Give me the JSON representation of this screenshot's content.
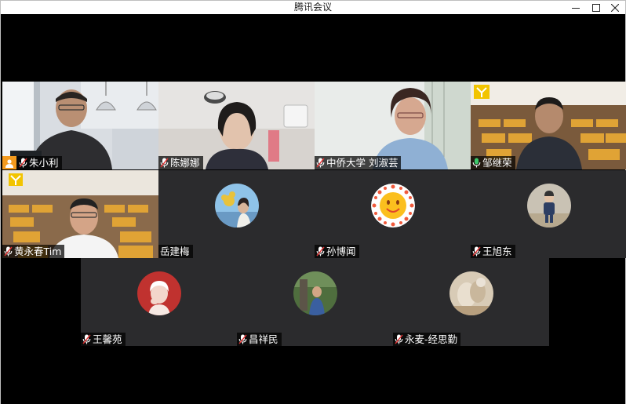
{
  "window": {
    "title": "腾讯会议",
    "minimize_icon": "minimize-icon",
    "maximize_icon": "maximize-icon",
    "close_icon": "close-icon"
  },
  "participants": [
    {
      "name": "朱小利",
      "host": true,
      "speaking": false,
      "video": true
    },
    {
      "name": "陈娜娜",
      "host": false,
      "speaking": false,
      "video": true
    },
    {
      "name": "中侨大学 刘淑芸",
      "host": false,
      "speaking": false,
      "video": true
    },
    {
      "name": "邹继荣",
      "host": false,
      "speaking": true,
      "video": true
    },
    {
      "name": "黄永春Tim",
      "host": false,
      "speaking": false,
      "video": true
    },
    {
      "name": "岳建梅",
      "host": false,
      "speaking": false,
      "video": false
    },
    {
      "name": "孙博闻",
      "host": false,
      "speaking": false,
      "video": false
    },
    {
      "name": "王旭东",
      "host": false,
      "speaking": false,
      "video": false
    },
    {
      "name": "王馨苑",
      "host": false,
      "speaking": false,
      "video": false
    },
    {
      "name": "昌祥民",
      "host": false,
      "speaking": false,
      "video": false
    },
    {
      "name": "永麦-经思勤",
      "host": false,
      "speaking": false,
      "video": false
    }
  ],
  "colors": {
    "active_speaker_border": "#3cc96a",
    "host_badge": "#f39a1e",
    "tile_background": "#2b2b2d"
  }
}
